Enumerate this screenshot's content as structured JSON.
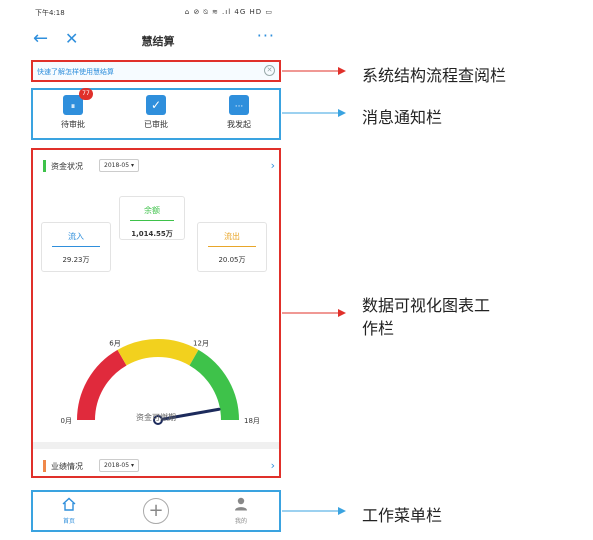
{
  "status_bar": {
    "time": "下午4:18",
    "right": "⌂ ⊘ ⍉ ≋ .ıl 4G HD ▭"
  },
  "nav": {
    "back_icon": "←",
    "close_icon": "✕",
    "title": "慧结算",
    "more_icon": "···"
  },
  "guide": {
    "text": "快速了解怎样使用慧结算",
    "close_icon": "✕"
  },
  "messages": [
    {
      "label": "待审批",
      "icon": "pause-icon",
      "glyph": "⏸",
      "badge": "77"
    },
    {
      "label": "已审批",
      "icon": "check-icon",
      "glyph": "✓",
      "badge": ""
    },
    {
      "label": "我发起",
      "icon": "dots-icon",
      "glyph": "···",
      "badge": ""
    }
  ],
  "finance": {
    "title": "资金状况",
    "period": "2018-05 ▾",
    "arrow": "›",
    "accent": "#3ec24a",
    "balance": {
      "label": "余额",
      "value": "1,014.55万",
      "color": "#3ec24a"
    },
    "inflow": {
      "label": "流入",
      "value": "29.23万",
      "color": "#2f8fdc"
    },
    "outflow": {
      "label": "流出",
      "value": "20.05万",
      "color": "#e8a62a"
    },
    "gauge": {
      "tick_0": "0月",
      "tick_6": "6月",
      "tick_12": "12月",
      "tick_18": "18月",
      "caption": "资金可燃期",
      "value_months": 17,
      "segments": [
        {
          "from": 0,
          "to": 6,
          "color": "#e02a3c"
        },
        {
          "from": 6,
          "to": 12,
          "color": "#f2d11e"
        },
        {
          "from": 12,
          "to": 18,
          "color": "#3ec24a"
        }
      ]
    }
  },
  "performance": {
    "title": "业绩情况",
    "period": "2018-05 ▾",
    "arrow": "›",
    "accent": "#f0884a"
  },
  "tabbar": {
    "home": {
      "label": "首页",
      "icon": "home-icon",
      "color": "#2f8fdc"
    },
    "add": {
      "glyph": "+"
    },
    "mine": {
      "label": "我的",
      "icon": "user-icon",
      "color": "#888888"
    }
  },
  "annotations": {
    "structure": "系统结构流程查阅栏",
    "message": "消息通知栏",
    "chart_line1": "数据可视化图表工",
    "chart_line2": "作栏",
    "menu": "工作菜单栏"
  },
  "colors": {
    "red_box": "#e0302a",
    "blue_box": "#3aa3e0"
  }
}
